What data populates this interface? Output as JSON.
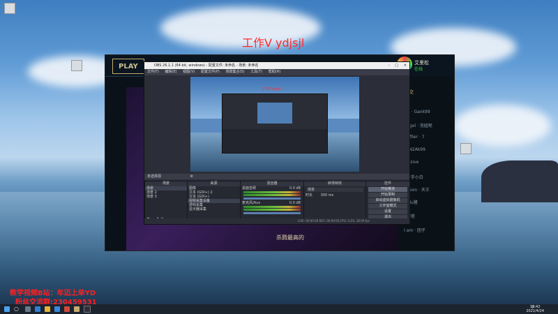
{
  "watermark": {
    "top": "工作V ydjsjl"
  },
  "promo": {
    "line1": "教学视频B站：年迈上单YD",
    "line2": "粉丝交流群:230459531"
  },
  "lol": {
    "play": "PLAY",
    "banner_text": "杀戮最高的",
    "user_name": "艾里松",
    "user_status": "在线",
    "friends_header": "社交",
    "friends": [
      "AD · Gank99",
      "Angel · 泡妞呢",
      "Defiler · 7",
      "PEN2Ak99",
      "Elusive",
      "· 新手小白",
      "Fusion · 天王",
      "Hulu猪",
      "· 刀塔",
      "I am · 团子"
    ]
  },
  "obs": {
    "title": "OBS 26.1.1 (64-bit, windows) - 配置文件: 未命名 - 场景: 未命名",
    "menu": [
      "文件(F)",
      "编辑(E)",
      "视图(V)",
      "配置文件(P)",
      "场景集合(S)",
      "工具(T)",
      "帮助(H)"
    ],
    "preview_text": "工作V ydjsjl",
    "source_bar": "未选择源",
    "docks": {
      "scenes": {
        "title": "场景",
        "items": [
          "场景",
          "场景 2",
          "场景 3"
        ]
      },
      "sources": {
        "title": "来源",
        "items": [
          "图像",
          "文本 (GDI+) 2",
          "文本 (GDI+)",
          "视频采集设备",
          "游戏采集",
          "显示器采集"
        ]
      },
      "mixer": {
        "title": "混音器",
        "ch1": "桌面音频",
        "ch1_db": "0.0 dB",
        "ch2": "麦克风/Aux",
        "ch2_db": "0.0 dB"
      },
      "transitions": {
        "title": "转场特效",
        "type": "渐变",
        "duration_label": "时长",
        "duration": "300 ms"
      },
      "controls": {
        "title": "控件",
        "buttons": [
          "开始推流",
          "开始录制",
          "启动虚拟摄像机",
          "工作室模式",
          "设置",
          "退出"
        ]
      }
    },
    "status": "LIVE: 00:00:00    REC: 00:00:00    CPU: 3.4%, 30.00 fps"
  },
  "taskbar": {
    "time": "19:42",
    "date": "2021/4/24",
    "lang": "中"
  }
}
